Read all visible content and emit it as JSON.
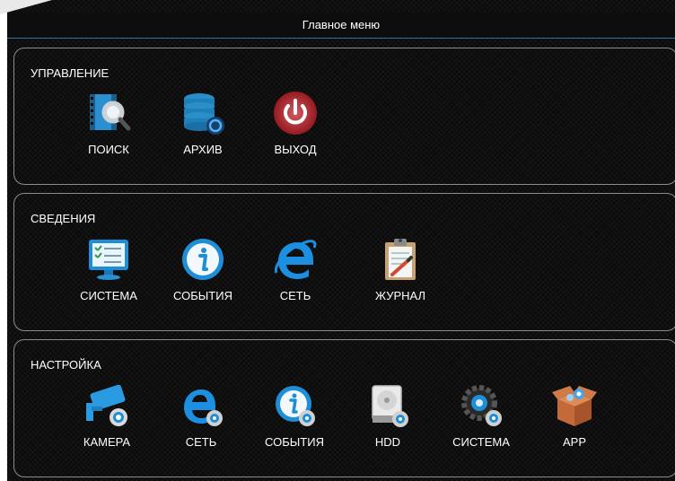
{
  "header": {
    "title": "Главное меню"
  },
  "groups": [
    {
      "label": "УПРАВЛЕНИЕ",
      "items": [
        {
          "label": "ПОИСК",
          "icon": "search-film-icon"
        },
        {
          "label": "АРХИВ",
          "icon": "database-backup-icon"
        },
        {
          "label": "ВЫХОД",
          "icon": "power-icon"
        }
      ]
    },
    {
      "label": "СВЕДЕНИЯ",
      "items": [
        {
          "label": "СИСТЕМА",
          "icon": "monitor-checklist-icon"
        },
        {
          "label": "СОБЫТИЯ",
          "icon": "info-icon"
        },
        {
          "label": "СЕТЬ",
          "icon": "internet-e-icon"
        },
        {
          "label": "ЖУРНАЛ",
          "icon": "clipboard-log-icon"
        }
      ]
    },
    {
      "label": "НАСТРОЙКА",
      "items": [
        {
          "label": "КАМЕРА",
          "icon": "camera-settings-icon"
        },
        {
          "label": "СЕТЬ",
          "icon": "network-settings-icon"
        },
        {
          "label": "СОБЫТИЯ",
          "icon": "events-settings-icon"
        },
        {
          "label": "HDD",
          "icon": "hdd-icon"
        },
        {
          "label": "СИСТЕМА",
          "icon": "system-settings-icon"
        },
        {
          "label": "APP",
          "icon": "app-box-icon"
        }
      ]
    }
  ],
  "colors": {
    "accent_blue": "#1e9be4",
    "power_red": "#c4232b",
    "frame_border": "#8c8c8c",
    "header_line": "#3a6e9c"
  }
}
